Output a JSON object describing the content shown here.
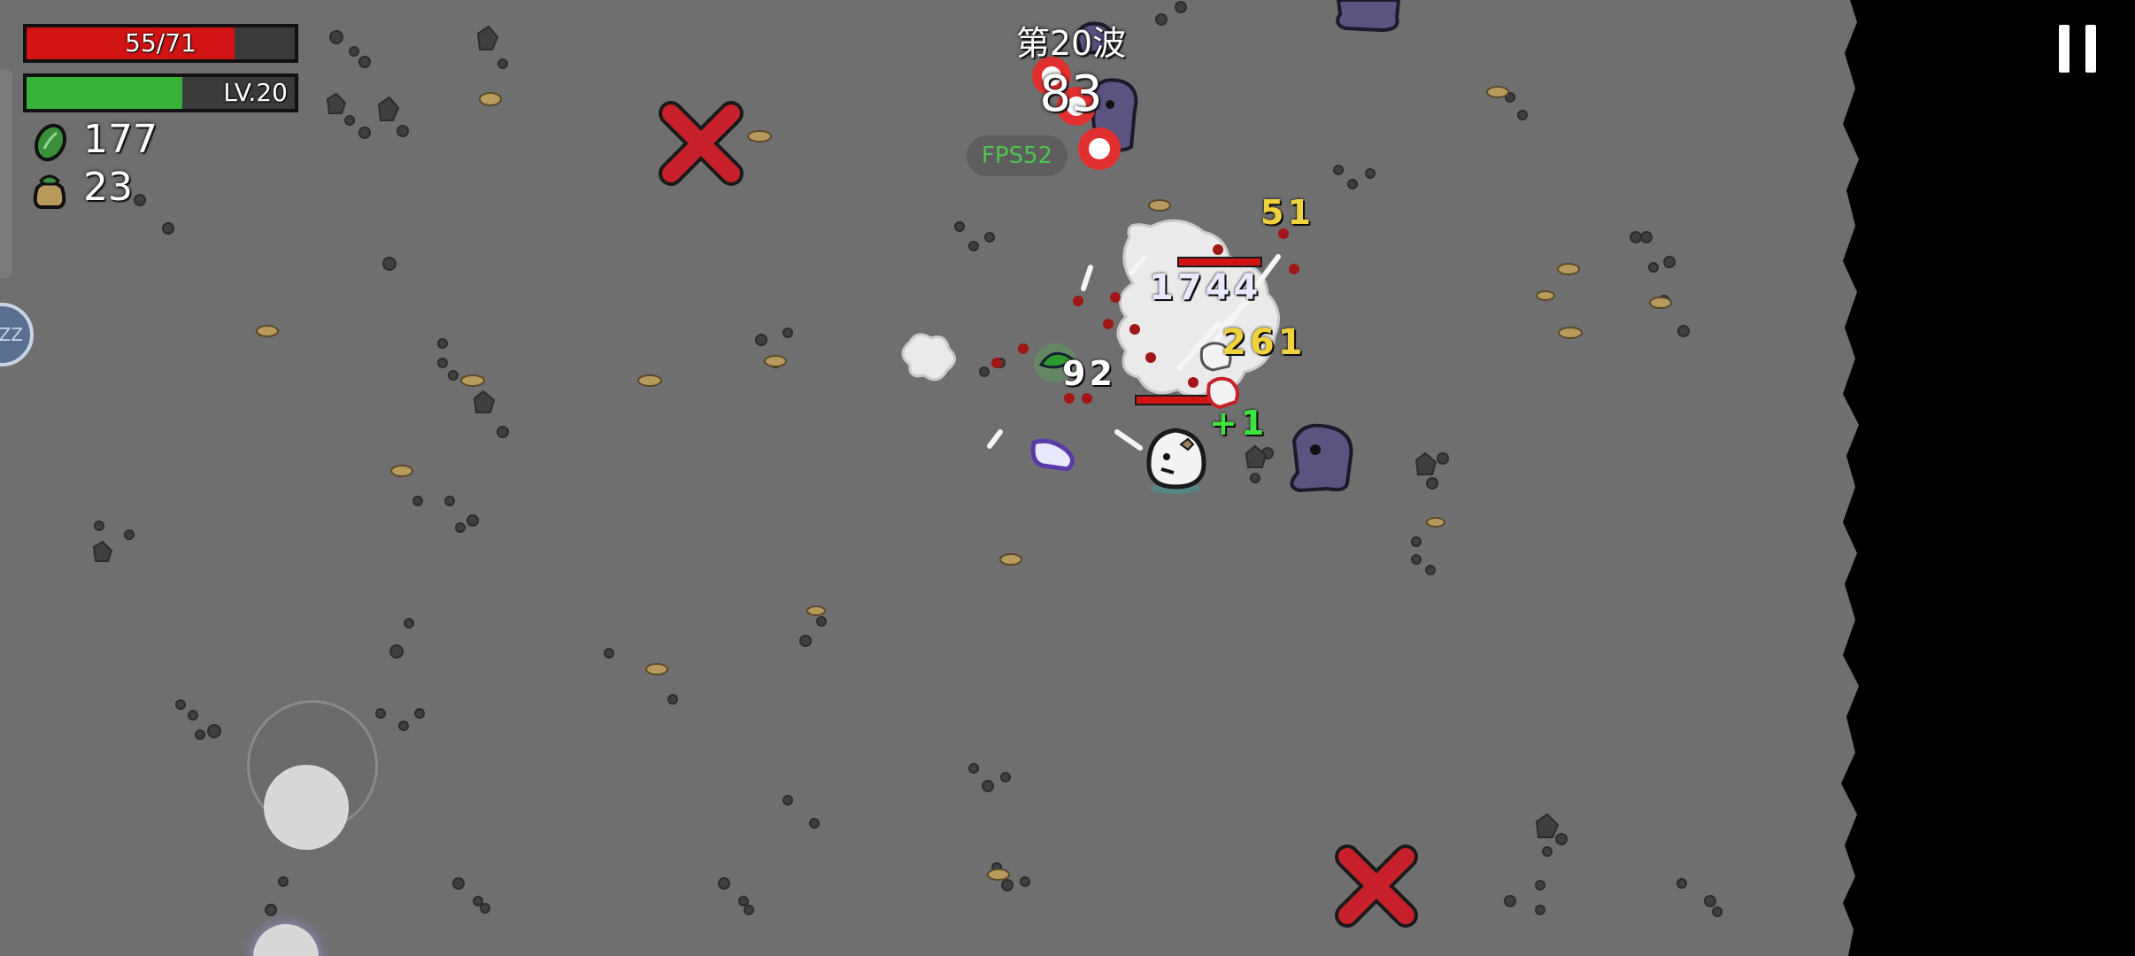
{
  "hud": {
    "hp_text": "55/71",
    "hp_fraction": 0.7746,
    "level_text": "LV.20",
    "xp_fraction": 0.58,
    "materials_count": "177",
    "bag_count": "23",
    "wave_label": "第20波",
    "wave_timer": "83",
    "fps_label": "FPS52"
  },
  "damage_numbers": {
    "n51": "51",
    "n1744": "1744",
    "n261": "261",
    "n92": "92",
    "heal": "+1"
  },
  "sleep_label": "ZZ",
  "colors": {
    "hp": "#d21313",
    "xp": "#36b336",
    "enemy": "#5c5380",
    "spawn_marker": "#c8202a",
    "damage_yellow": "#f0d23c",
    "heal_green": "#3ee43e",
    "fps_text": "#4fc24f"
  },
  "icons": [
    "materials-icon",
    "money-bag-icon",
    "pause-icon",
    "sleep-icon"
  ]
}
